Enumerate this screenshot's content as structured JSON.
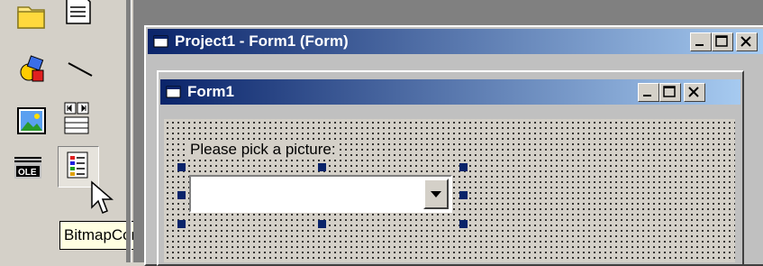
{
  "toolbox": {
    "tools": [
      {
        "icon": "folder-icon"
      },
      {
        "icon": "file-icon"
      },
      {
        "icon": "shape-icon"
      },
      {
        "icon": "line-icon"
      },
      {
        "icon": "image-icon"
      },
      {
        "icon": "data-control-icon"
      },
      {
        "icon": "ole-icon"
      },
      {
        "icon": "bitmap-combo-icon",
        "selected": true
      }
    ],
    "tooltip": "BitmapCombo"
  },
  "project_window": {
    "title": "Project1 - Form1 (Form)"
  },
  "form": {
    "title": "Form1",
    "label_text": "Please pick a picture:",
    "combo_value": ""
  },
  "colors": {
    "titlebar_start": "#0a246a",
    "titlebar_end": "#a6caf0",
    "selection_handle": "#0a246a",
    "tooltip_bg": "#ffffe1"
  }
}
